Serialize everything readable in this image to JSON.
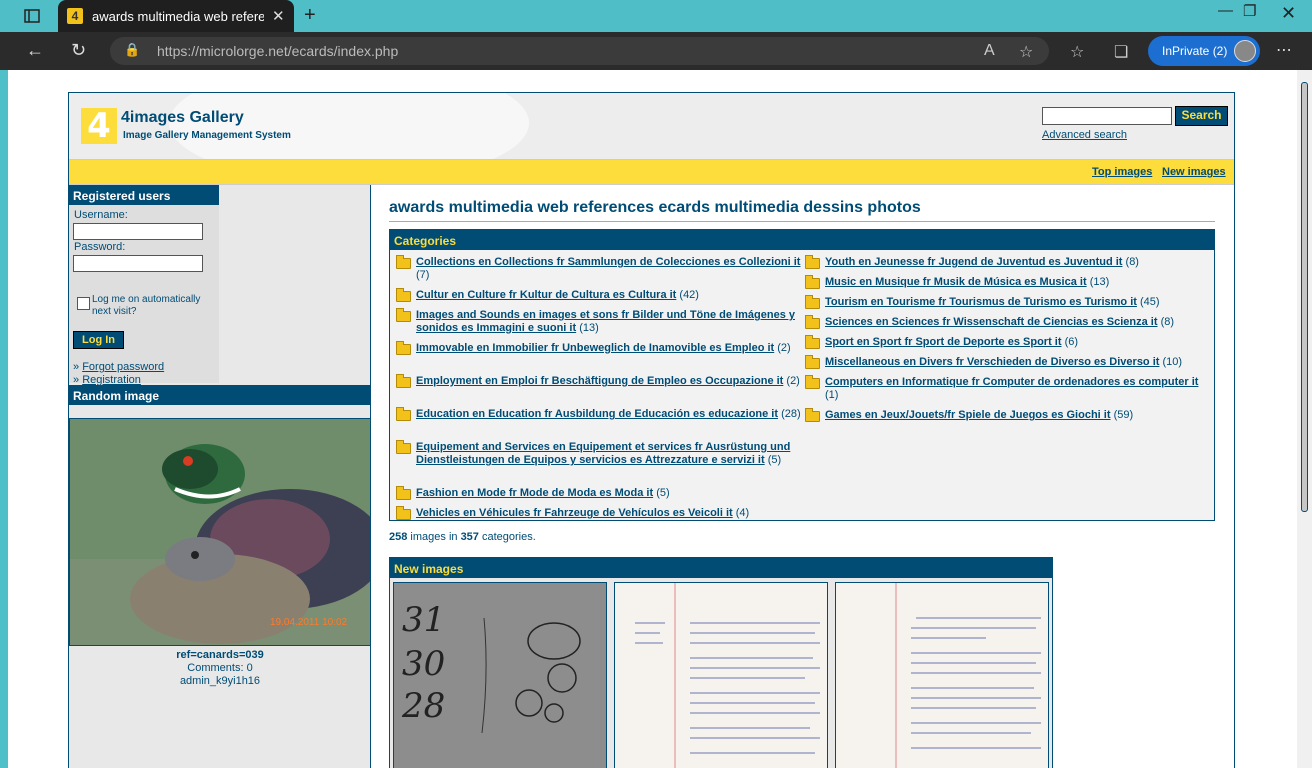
{
  "browser": {
    "tab_title": "awards multimedia web referenc",
    "url": "https://microlorge.net/ecards/index.php",
    "inprivate_label": "InPrivate (2)"
  },
  "header": {
    "logo_name": "4images Gallery",
    "logo_subtitle": "Image Gallery Management System",
    "search_button": "Search",
    "advanced_search": "Advanced search",
    "top_images": "Top images",
    "new_images": "New images"
  },
  "sidebar": {
    "registered_users": "Registered users",
    "username_label": "Username:",
    "password_label": "Password:",
    "remember_label": "Log me on automatically next visit?",
    "login_button": "Log In",
    "forgot_password": "Forgot password",
    "registration": "Registration",
    "random_image_title": "Random image",
    "random_image_name": "ref=canards=039",
    "random_image_comments": "Comments: 0",
    "random_image_user": "admin_k9yi1h16"
  },
  "main": {
    "page_title": "awards multimedia web references ecards multimedia dessins photos",
    "categories_title": "Categories",
    "categories_left": [
      {
        "name": "Collections en Collections fr Sammlungen de Colecciones es Collezioni it",
        "count": "(7)"
      },
      {
        "name": "Cultur en Culture fr Kultur de Cultura es Cultura it",
        "count": "(42)"
      },
      {
        "name": "Images and Sounds en images et sons fr Bilder und Töne de Imágenes y sonidos es Immagini e suoni it",
        "count": "(13)"
      },
      {
        "name": "Immovable en Immobilier fr Unbeweglich de Inamovible es Empleo it",
        "count": "(2)"
      },
      {
        "name": "Employment en Emploi fr Beschäftigung de Empleo es Occupazione it",
        "count": "(2)"
      },
      {
        "name": "Education en Education fr Ausbildung de Educación es educazione it",
        "count": "(28)"
      },
      {
        "name": "Equipement and Services en Equipement et services fr Ausrüstung und Dienstleistungen de Equipos y servicios es Attrezzature e servizi it",
        "count": "(5)"
      },
      {
        "name": "Fashion en Mode fr Mode de Moda es Moda it",
        "count": "(5)"
      },
      {
        "name": "Vehicles en Véhicules fr Fahrzeuge de Vehículos es Veicoli it",
        "count": "(4)"
      }
    ],
    "categories_right": [
      {
        "name": "Youth en Jeunesse fr Jugend de Juventud es Juventud it",
        "count": "(8)"
      },
      {
        "name": "Music en Musique fr Musik de Música es Musica it",
        "count": "(13)"
      },
      {
        "name": "Tourism en Tourisme fr Tourismus de Turismo es Turismo it",
        "count": "(45)"
      },
      {
        "name": "Sciences en Sciences fr Wissenschaft de Ciencias es Scienza it",
        "count": "(8)"
      },
      {
        "name": "Sport en Sport fr Sport de Deporte es Sport it",
        "count": "(6)"
      },
      {
        "name": "Miscellaneous en Divers fr Verschieden de Diverso es Diverso it",
        "count": "(10)"
      },
      {
        "name": "Computers en Informatique fr Computer de ordenadores es computer it",
        "count": "(1)"
      },
      {
        "name": "Games en Jeux/Jouets/fr Spiele de Juegos es Giochi it",
        "count": "(59)"
      }
    ],
    "stats_images": "258",
    "stats_mid": "images in",
    "stats_categories": "357",
    "stats_end": "categories.",
    "new_images_title": "New images"
  },
  "colors": {
    "brand": "#004c75",
    "accent": "#fcdd3b"
  }
}
